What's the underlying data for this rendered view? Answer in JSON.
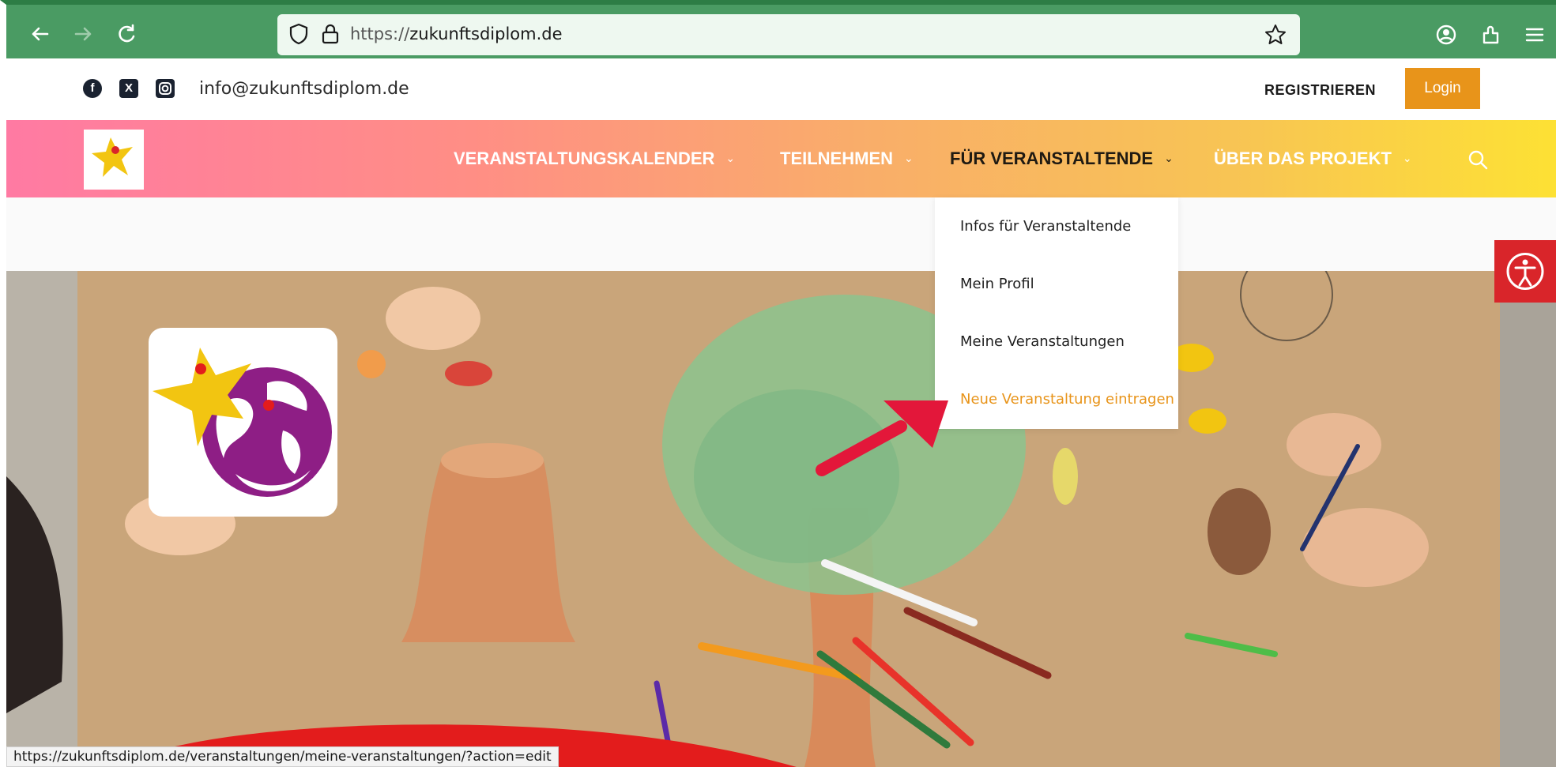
{
  "browser": {
    "url_scheme": "https://",
    "url_host": "zukunftsdiplom.de",
    "back_icon": "arrow-left-icon",
    "forward_icon": "arrow-right-icon",
    "reload_icon": "reload-icon"
  },
  "topbar": {
    "email": "info@zukunftsdiplom.de",
    "register_label": "REGISTRIEREN",
    "login_label": "Login",
    "social": [
      "facebook-icon",
      "x-icon",
      "instagram-icon"
    ]
  },
  "nav": {
    "items": [
      {
        "label": "VERANSTALTUNGSKALENDER",
        "chevron": "⌄"
      },
      {
        "label": "TEILNEHMEN",
        "chevron": "⌄"
      },
      {
        "label": "FÜR VERANSTALTENDE",
        "chevron": "⌄"
      },
      {
        "label": "ÜBER DAS PROJEKT",
        "chevron": "⌄"
      }
    ],
    "active_index": 2
  },
  "dropdown": {
    "items": [
      {
        "label": "Infos für Veranstaltende"
      },
      {
        "label": "Mein Profil"
      },
      {
        "label": "Meine Veranstaltungen"
      },
      {
        "label": "Neue Veranstaltung eintragen"
      }
    ],
    "highlight_index": 3
  },
  "statusbar": {
    "link": "https://zukunftsdiplom.de/veranstaltungen/meine-veranstaltungen/?action=edit"
  },
  "colors": {
    "browser_green": "#4a9b63",
    "accent_orange": "#e8941a",
    "a11y_red": "#d9252a",
    "logo_purple": "#8e1e85",
    "logo_yellow": "#f2c511"
  }
}
